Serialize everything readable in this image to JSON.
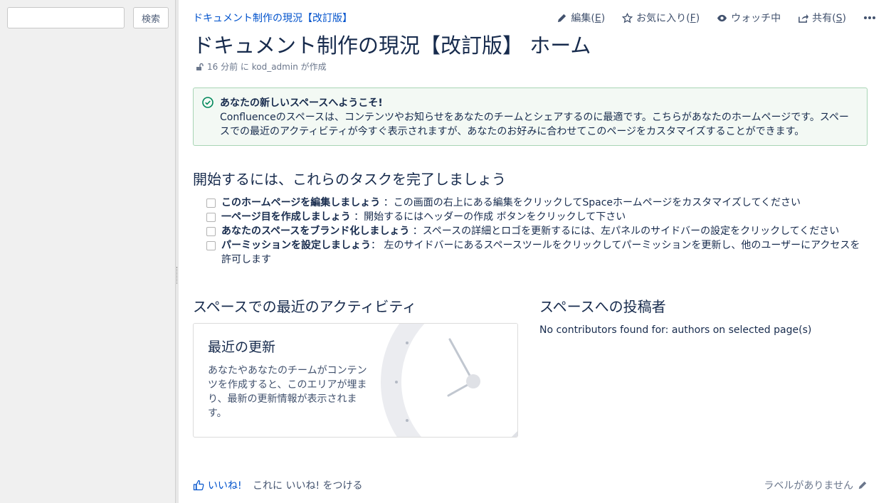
{
  "sidebar": {
    "search_placeholder": "",
    "search_button": "検索"
  },
  "header": {
    "breadcrumb": "ドキュメント制作の現況【改訂版】",
    "actions": {
      "edit": "編集",
      "edit_key": "E",
      "favorite": "お気に入り",
      "favorite_key": "F",
      "watch": "ウォッチ中",
      "share": "共有",
      "share_key": "S"
    },
    "title": "ドキュメント制作の現況【改訂版】 ホーム",
    "meta": "16 分前 に kod_admin が作成"
  },
  "welcome": {
    "title": "あなたの新しいスペースへようこそ!",
    "body": "Confluenceのスペースは、コンテンツやお知らせをあなたのチームとシェアするのに最適です。こちらがあなたのホームページです。スペースでの最近のアクティビティが今すぐ表示されますが、あなたのお好みに合わせてこのページをカスタマイズすることができます。"
  },
  "tasks": {
    "title": "開始するには、これらのタスクを完了しましょう",
    "items": [
      {
        "bold": "このホームページを編集しましょう",
        "text": " ：この画面の右上にある編集をクリックしてSpaceホームページをカスタマイズしてください"
      },
      {
        "bold": "一ページ目を作成しましょう",
        "text": " ：開始するにはヘッダーの作成 ボタンをクリックして下さい"
      },
      {
        "bold": "あなたのスペースをブランド化しましょう",
        "text": " ：スペースの詳細とロゴを更新するには、左パネルのサイドバーの設定をクリックしてください"
      },
      {
        "bold": "パーミッションを設定しましょう",
        "text": "： 左のサイドバーにあるスペースツールをクリックしてパーミッションを更新し、他のユーザーにアクセスを許可します"
      }
    ]
  },
  "activity": {
    "title": "スペースでの最近のアクティビティ",
    "card_title": "最近の更新",
    "card_body": "あなたやあなたのチームがコンテンツを作成すると、このエリアが埋まり、最新の更新情報が表示されます。"
  },
  "contributors": {
    "title": "スペースへの投稿者",
    "empty": "No contributors found for: authors on selected page(s)"
  },
  "footer": {
    "like": "いいね!",
    "like_prompt": "これに いいね! をつける",
    "labels": "ラベルがありません"
  },
  "colors": {
    "link": "#0052cc",
    "success_bg": "#f3f9f4",
    "success_icon": "#00875a"
  }
}
